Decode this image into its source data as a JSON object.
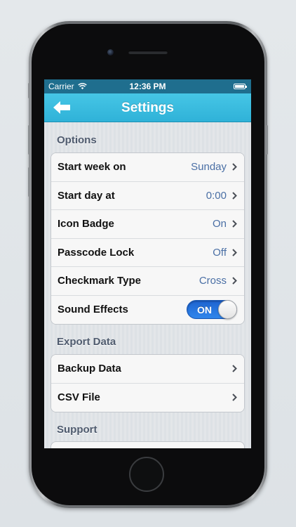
{
  "status_bar": {
    "carrier": "Carrier",
    "time": "12:36 PM"
  },
  "nav": {
    "title": "Settings",
    "back_icon": "left-arrow-icon"
  },
  "sections": {
    "options": {
      "header": "Options",
      "rows": [
        {
          "label": "Start week on",
          "value": "Sunday"
        },
        {
          "label": "Start day at",
          "value": "0:00"
        },
        {
          "label": "Icon Badge",
          "value": "On"
        },
        {
          "label": "Passcode Lock",
          "value": "Off"
        },
        {
          "label": "Checkmark Type",
          "value": "Cross"
        },
        {
          "label": "Sound Effects",
          "toggle": "ON"
        }
      ]
    },
    "export": {
      "header": "Export Data",
      "rows": [
        {
          "label": "Backup Data"
        },
        {
          "label": "CSV File"
        }
      ]
    },
    "support": {
      "header": "Support"
    }
  },
  "colors": {
    "nav_bar": "#33b6dc",
    "status_bar": "#1f6e8e",
    "value_text": "#4a6fa5",
    "toggle_on": "#2a7ae4"
  }
}
